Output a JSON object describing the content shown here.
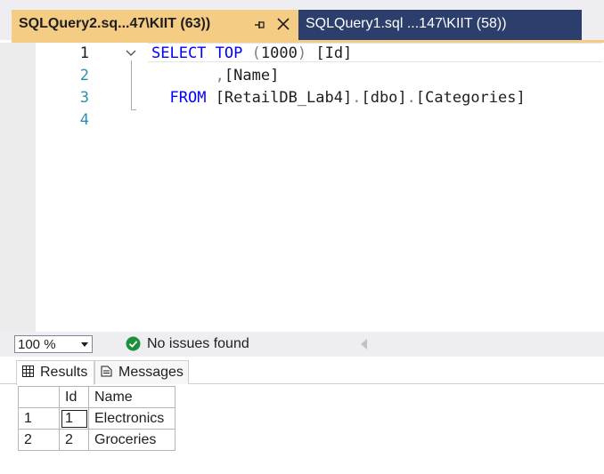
{
  "tabs": {
    "active_title": "SQLQuery2.sq...47\\KIIT (63))",
    "inactive_title": "SQLQuery1.sql ...147\\KIIT (58))"
  },
  "editor": {
    "line_numbers": [
      "1",
      "2",
      "3",
      "4"
    ],
    "lines": {
      "l1_kw1": "SELECT",
      "l1_kw2": "TOP",
      "l1_p_open": "(",
      "l1_num": "1000",
      "l1_p_close": ")",
      "l1_col": "[Id]",
      "l2_comma": ",",
      "l2_col": "[Name]",
      "l3_kw": "FROM",
      "l3_db": "[RetailDB_Lab4]",
      "l3_dot1": ".",
      "l3_schema": "[dbo]",
      "l3_dot2": ".",
      "l3_table": "[Categories]"
    },
    "colors": {
      "keyword": "#0000ff",
      "punct": "#808080",
      "line_number": "#2b91af"
    }
  },
  "status": {
    "zoom": "100 %",
    "issues": "No issues found"
  },
  "results": {
    "tab_results": "Results",
    "tab_messages": "Messages",
    "columns": [
      "Id",
      "Name"
    ],
    "rows": [
      {
        "rownum": "1",
        "id": "1",
        "name": "Electronics"
      },
      {
        "rownum": "2",
        "id": "2",
        "name": "Groceries"
      }
    ]
  },
  "colors": {
    "active_tab": "#f5cc84",
    "inactive_tab": "#2c3f6c",
    "success_icon": "#1e8f3a"
  }
}
